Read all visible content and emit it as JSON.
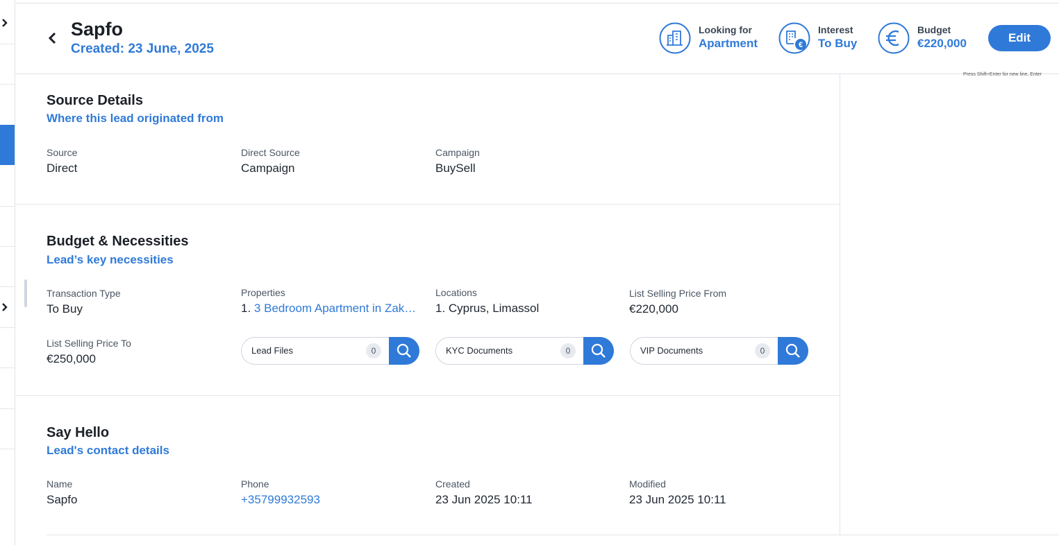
{
  "header": {
    "name": "Sapfo",
    "created": "Created: 23 June, 2025",
    "stats": [
      {
        "label": "Looking for",
        "value": "Apartment",
        "icon": "building-icon"
      },
      {
        "label": "Interest",
        "value": "To Buy",
        "icon": "interest-buy-icon"
      },
      {
        "label": "Budget",
        "value": "€220,000",
        "icon": "euro-icon"
      }
    ],
    "edit_label": "Edit",
    "hint": "Press Shift+Enter for new line, Enter"
  },
  "source": {
    "title": "Source Details",
    "subtitle": "Where this lead originated from",
    "fields": [
      {
        "label": "Source",
        "value": "Direct"
      },
      {
        "label": "Direct Source",
        "value": "Campaign"
      },
      {
        "label": "Campaign",
        "value": "BuySell"
      }
    ]
  },
  "budget": {
    "title": "Budget & Necessities",
    "subtitle": "Lead’s key necessities",
    "transaction_type": {
      "label": "Transaction Type",
      "value": "To Buy"
    },
    "properties": {
      "label": "Properties",
      "index": "1.",
      "value": "3 Bedroom Apartment in Zak…"
    },
    "locations": {
      "label": "Locations",
      "value": "1. Cyprus, Limassol"
    },
    "price_from": {
      "label": "List Selling Price From",
      "value": "€220,000"
    },
    "price_to": {
      "label": "List Selling Price To",
      "value": "€250,000"
    },
    "documents": [
      {
        "label": "Lead Files",
        "count": "0"
      },
      {
        "label": "KYC Documents",
        "count": "0"
      },
      {
        "label": "VIP Documents",
        "count": "0"
      }
    ]
  },
  "contact": {
    "title": "Say Hello",
    "subtitle": "Lead's contact details",
    "fields": [
      {
        "label": "Name",
        "value": "Sapfo"
      },
      {
        "label": "Phone",
        "value": "+35799932593"
      },
      {
        "label": "Created",
        "value": "23 Jun 2025 10:11"
      },
      {
        "label": "Modified",
        "value": "23 Jun 2025 10:11"
      }
    ]
  },
  "colors": {
    "accent": "#2f7ad8",
    "text": "#1b1f26",
    "muted": "#4a5563",
    "border": "#dfe3e8"
  }
}
